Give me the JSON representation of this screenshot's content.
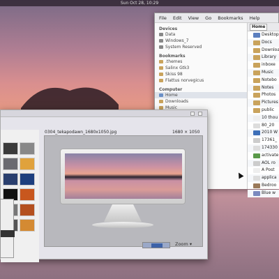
{
  "topbar": {
    "clock": "Sun Oct 28, 10:29"
  },
  "file_manager": {
    "menu": [
      "File",
      "Edit",
      "View",
      "Go",
      "Bookmarks",
      "Help"
    ],
    "sidebar": {
      "devices_header": "Devices",
      "devices": [
        "Data",
        "Windows_7",
        "System Reserved"
      ],
      "bookmarks_header": "Bookmarks",
      "bookmarks": [
        ".themes",
        "Salinx Gtk3",
        "Skiss 98",
        "Flattus norvegicus"
      ],
      "computer_header": "Computer",
      "computer": [
        "Home",
        "Downloads",
        "Music"
      ]
    },
    "location": "Home",
    "files": [
      "Desktop",
      "Docs",
      "Downloads",
      "Library",
      "inboxe",
      "Music",
      "Notebo",
      "Notes",
      "Photos",
      "Pictures",
      "public",
      "10 thou",
      "80_20",
      "2010 W",
      "17361_",
      "174330",
      "activate",
      "AOL ro",
      "A Post",
      "applica",
      "Bedroo",
      "Blue w"
    ]
  },
  "image_viewer": {
    "filename": "0304_tekapodawn_1680x1050.jpg",
    "dimensions": "1680 × 1050",
    "zoom_label": "Zoom"
  }
}
